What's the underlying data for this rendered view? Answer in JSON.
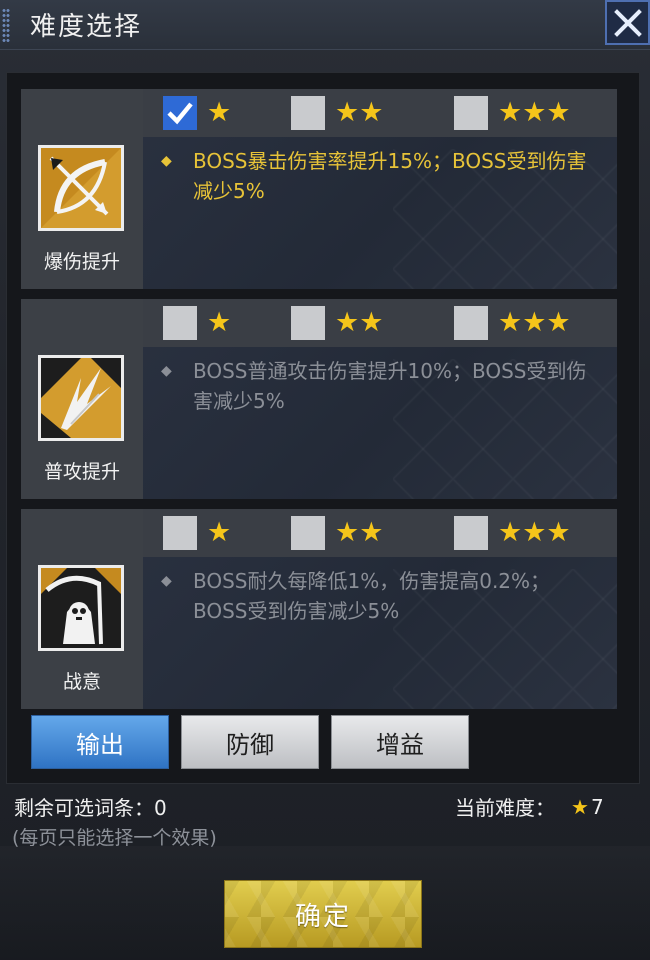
{
  "header": {
    "title": "难度选择"
  },
  "cards": [
    {
      "label": "爆伤提升",
      "icon": "bow-arrow-icon",
      "options": [
        {
          "stars": "★",
          "checked": true
        },
        {
          "stars": "★★",
          "checked": false
        },
        {
          "stars": "★★★",
          "checked": false
        }
      ],
      "bullet": "◆",
      "description": "BOSS暴击伤害率提升15%；BOSS受到伤害减少5%",
      "active": true
    },
    {
      "label": "普攻提升",
      "icon": "claw-slash-icon",
      "options": [
        {
          "stars": "★",
          "checked": false
        },
        {
          "stars": "★★",
          "checked": false
        },
        {
          "stars": "★★★",
          "checked": false
        }
      ],
      "bullet": "◆",
      "description": "BOSS普通攻击伤害提升10%；BOSS受到伤害减少5%",
      "active": false
    },
    {
      "label": "战意",
      "icon": "reaper-skull-icon",
      "options": [
        {
          "stars": "★",
          "checked": false
        },
        {
          "stars": "★★",
          "checked": false
        },
        {
          "stars": "★★★",
          "checked": false
        }
      ],
      "bullet": "◆",
      "description": "BOSS耐久每降低1%，伤害提高0.2%；BOSS受到伤害减少5%",
      "active": false
    }
  ],
  "tabs": [
    {
      "label": "输出",
      "active": true
    },
    {
      "label": "防御",
      "active": false
    },
    {
      "label": "增益",
      "active": false
    }
  ],
  "info": {
    "remaining_label": "剩余可选词条：",
    "remaining_value": "0",
    "note": "(每页只能选择一个效果)",
    "difficulty_label": "当前难度：",
    "difficulty_star": "★",
    "difficulty_value": "7"
  },
  "confirm_label": "确定",
  "colors": {
    "star": "#f5c51a",
    "active_text": "#e7c338",
    "tab_active": "#2f73c4",
    "checkbox_checked": "#2e6ad6",
    "confirm": "#c9b132"
  }
}
